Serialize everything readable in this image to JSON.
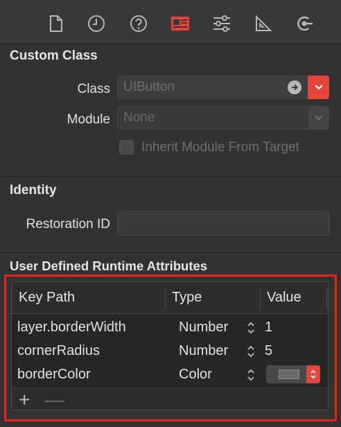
{
  "toolbar": {
    "tabs": [
      {
        "icon": "file-icon"
      },
      {
        "icon": "clock-icon"
      },
      {
        "icon": "help-icon"
      },
      {
        "icon": "identity-icon",
        "selected": true
      },
      {
        "icon": "sliders-icon"
      },
      {
        "icon": "ruler-icon"
      },
      {
        "icon": "connections-icon"
      }
    ],
    "accent": "#e4453b"
  },
  "custom_class": {
    "title": "Custom Class",
    "class_label": "Class",
    "class_placeholder": "UIButton",
    "module_label": "Module",
    "module_placeholder": "None",
    "inherit_label": "Inherit Module From Target",
    "inherit_checked": false
  },
  "identity": {
    "title": "Identity",
    "restoration_label": "Restoration ID",
    "restoration_value": ""
  },
  "runtime_attributes": {
    "title": "User Defined Runtime Attributes",
    "headers": {
      "key_path": "Key Path",
      "type": "Type",
      "value": "Value"
    },
    "rows": [
      {
        "key_path": "layer.borderWidth",
        "type": "Number",
        "value": "1"
      },
      {
        "key_path": "cornerRadius",
        "type": "Number",
        "value": "5"
      },
      {
        "key_path": "borderColor",
        "type": "Color",
        "value": ""
      }
    ],
    "add_label": "+",
    "remove_label": "—"
  }
}
